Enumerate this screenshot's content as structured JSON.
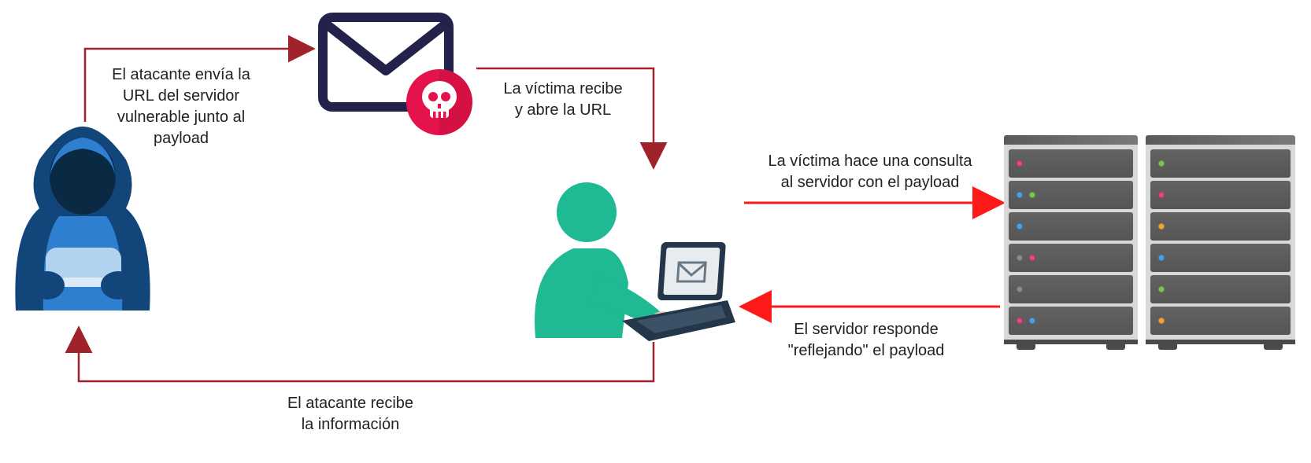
{
  "labels": {
    "attacker_sends": "El atacante envía la\nURL del servidor\nvulnerable junto al\npayload",
    "victim_opens": "La víctima recibe\ny abre la URL",
    "victim_query": "La víctima hace una consulta\nal servidor con el payload",
    "server_reflects": "El servidor responde\n\"reflejando\" el payload",
    "attacker_receives": "El atacante recibe\nla información"
  },
  "colors": {
    "arrow_darkred": "#a0222a",
    "arrow_red": "#ff1a1a",
    "hacker_darkblue": "#12467a",
    "hacker_blue": "#2f7fd1",
    "hacker_lightblue": "#b2d3f0",
    "envelope_stroke": "#22224a",
    "danger_red": "#e5134b",
    "danger_face": "#ffffff",
    "danger_shadow": "#b80e3a",
    "victim_teal": "#1fb994",
    "laptop_dark": "#23364a",
    "laptop_light": "#e9ecef",
    "skin": "#f6c9a6"
  },
  "icons": {
    "hacker": "hooded-hacker-icon",
    "mail": "malicious-mail-icon",
    "skull": "skull-icon",
    "victim": "user-laptop-icon",
    "server": "server-rack-icon"
  },
  "server_racks": [
    {
      "units": [
        {
          "leds": [
            "#e8477c"
          ]
        },
        {
          "leds": [
            "#4ea0e0",
            "#7cc64a"
          ]
        },
        {
          "leds": [
            "#4ea0e0"
          ]
        },
        {
          "leds": [
            "#8a8a8a",
            "#e8477c"
          ]
        },
        {
          "leds": [
            "#8a8a8a"
          ]
        },
        {
          "leds": [
            "#e8477c",
            "#4ea0e0"
          ]
        }
      ]
    },
    {
      "units": [
        {
          "leds": [
            "#7cc64a"
          ]
        },
        {
          "leds": [
            "#e8477c"
          ]
        },
        {
          "leds": [
            "#f2a23c"
          ]
        },
        {
          "leds": [
            "#4ea0e0"
          ]
        },
        {
          "leds": [
            "#7cc64a"
          ]
        },
        {
          "leds": [
            "#f2a23c"
          ]
        }
      ]
    }
  ]
}
